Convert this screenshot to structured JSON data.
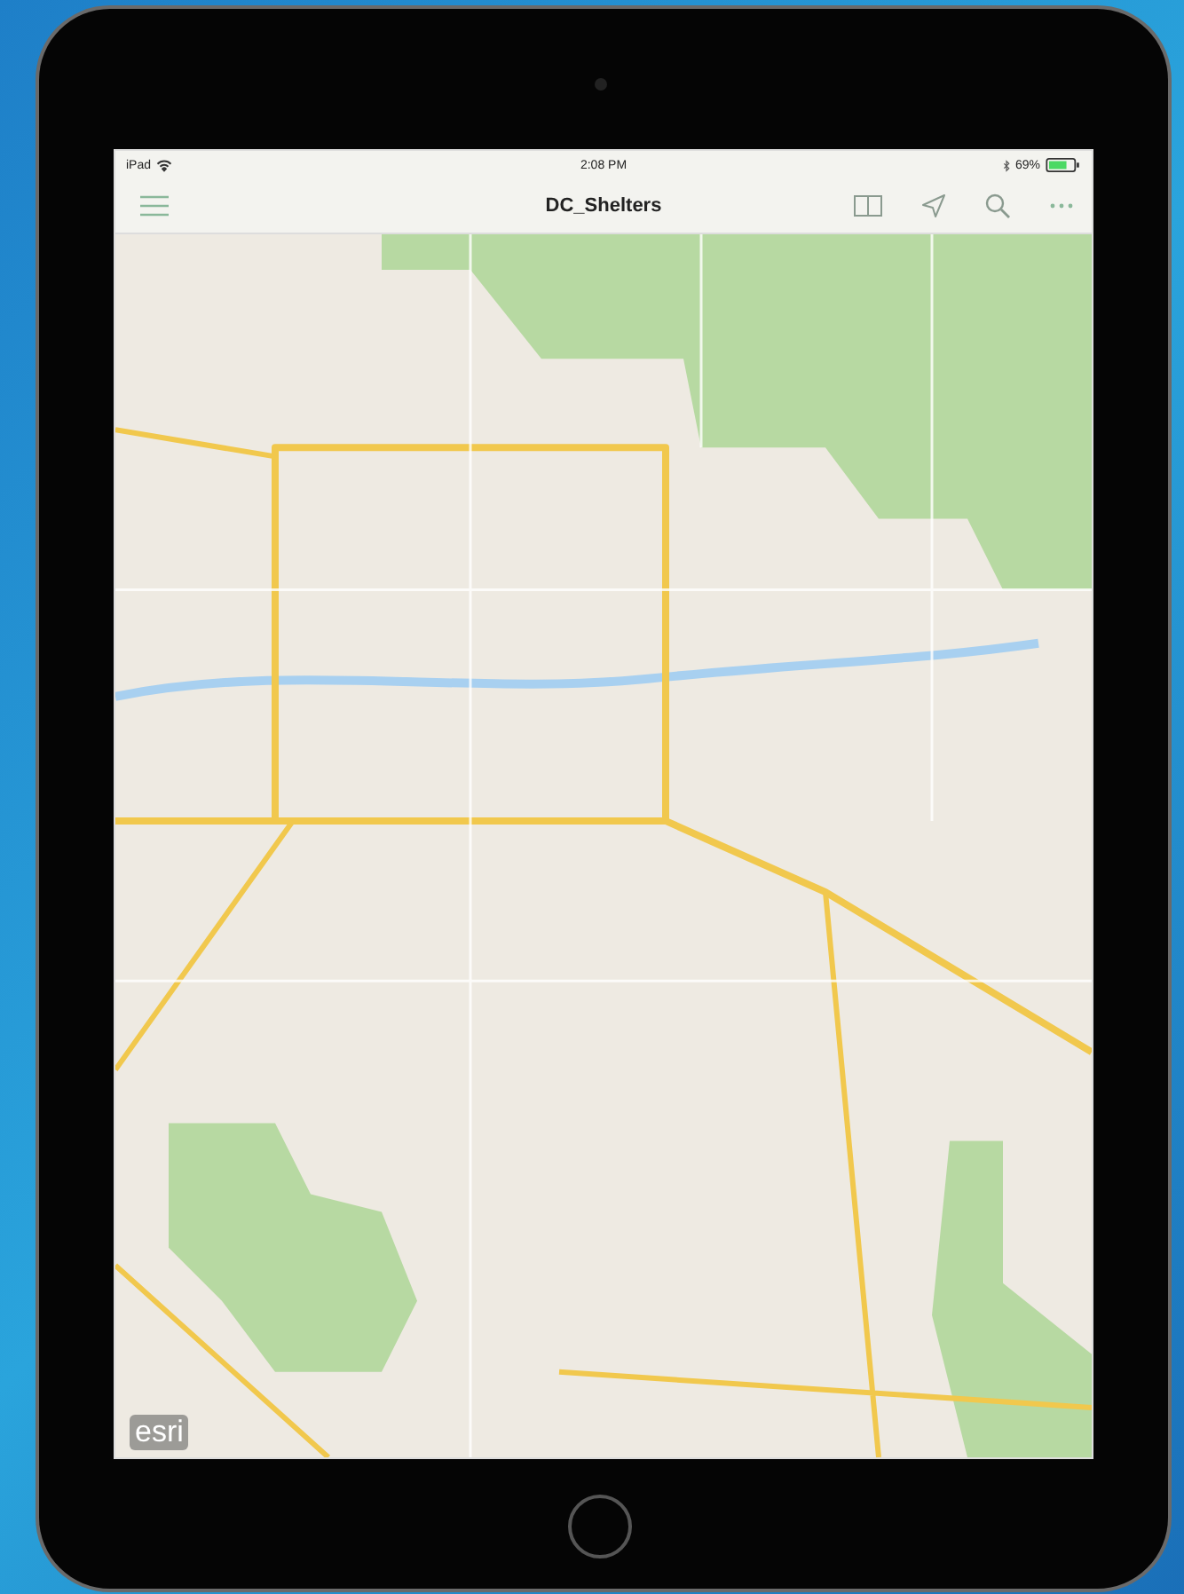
{
  "status_bar": {
    "carrier": "iPad",
    "time": "2:08 PM",
    "battery": "69%"
  },
  "nav_bar": {
    "title": "DC_Shelters"
  },
  "map": {
    "attribution": "esri"
  }
}
